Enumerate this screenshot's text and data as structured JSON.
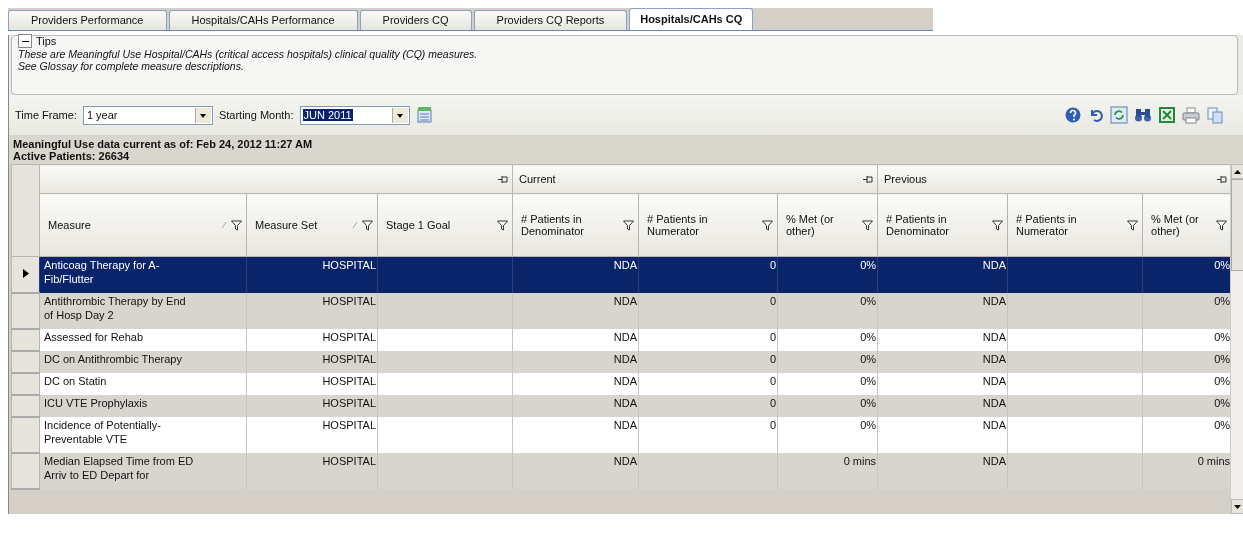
{
  "tabs": [
    {
      "label": "Providers Performance",
      "selected": false
    },
    {
      "label": "Hospitals/CAHs Performance",
      "selected": false
    },
    {
      "label": "Providers CQ",
      "selected": false
    },
    {
      "label": "Providers CQ Reports",
      "selected": false
    },
    {
      "label": "Hospitals/CAHs CQ",
      "selected": true
    }
  ],
  "tips": {
    "title": "Tips",
    "expanded": true,
    "lines": [
      "These are Meaningful Use Hospital/CAHs (critical access hospitals) clinical quality (CQ) measures.",
      "See Glossay for complete measure descriptions."
    ]
  },
  "filters": {
    "time_frame": {
      "label": "Time Frame:",
      "value": "1 year"
    },
    "starting_month": {
      "label": "Starting Month:",
      "value": "JUN 2011"
    }
  },
  "info": {
    "data_current": "Meaningful Use data current as of:  Feb 24, 2012 11:27 AM",
    "active_patients": "Active Patients: 26634"
  },
  "table": {
    "groups": [
      {
        "label": "Current"
      },
      {
        "label": "Previous"
      }
    ],
    "columns": [
      {
        "label": "Measure",
        "sortable": true
      },
      {
        "label": "Measure Set",
        "sortable": true
      },
      {
        "label": "Stage 1 Goal",
        "sortable": false
      },
      {
        "label": "# Patients in Denominator",
        "sortable": false
      },
      {
        "label": "# Patients in Numerator",
        "sortable": false
      },
      {
        "label": "% Met (or other)",
        "sortable": false
      },
      {
        "label": "# Patients in Denominator",
        "sortable": false
      },
      {
        "label": "# Patients in Numerator",
        "sortable": false
      },
      {
        "label": "% Met (or other)",
        "sortable": false
      }
    ],
    "rows": [
      {
        "selected": true,
        "cells": [
          "Anticoag Therapy for A-Fib/Flutter",
          "HOSPITAL",
          "",
          "NDA",
          "0",
          "0%",
          "NDA",
          "",
          "0%"
        ]
      },
      {
        "selected": false,
        "cells": [
          "Antithrombic Therapy by End of Hosp Day 2",
          "HOSPITAL",
          "",
          "NDA",
          "0",
          "0%",
          "NDA",
          "",
          "0%"
        ]
      },
      {
        "selected": false,
        "cells": [
          "Assessed for Rehab",
          "HOSPITAL",
          "",
          "NDA",
          "0",
          "0%",
          "NDA",
          "",
          "0%"
        ]
      },
      {
        "selected": false,
        "cells": [
          "DC on Antithrombic Therapy",
          "HOSPITAL",
          "",
          "NDA",
          "0",
          "0%",
          "NDA",
          "",
          "0%"
        ]
      },
      {
        "selected": false,
        "cells": [
          "DC on Statin",
          "HOSPITAL",
          "",
          "NDA",
          "0",
          "0%",
          "NDA",
          "",
          "0%"
        ]
      },
      {
        "selected": false,
        "cells": [
          "ICU VTE Prophylaxis",
          "HOSPITAL",
          "",
          "NDA",
          "0",
          "0%",
          "NDA",
          "",
          "0%"
        ]
      },
      {
        "selected": false,
        "cells": [
          "Incidence of Potentially-Preventable VTE",
          "HOSPITAL",
          "",
          "NDA",
          "0",
          "0%",
          "NDA",
          "",
          "0%"
        ]
      },
      {
        "selected": false,
        "cells": [
          "Median Elapsed Time from ED Arriv to ED Depart for",
          "HOSPITAL",
          "",
          "NDA",
          "",
          "0 mins",
          "NDA",
          "",
          "0 mins"
        ]
      }
    ]
  }
}
